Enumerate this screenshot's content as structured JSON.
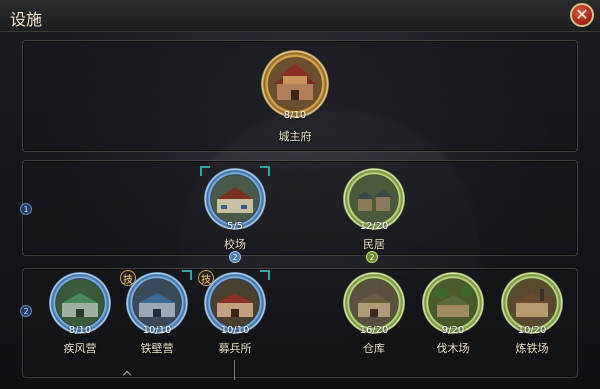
{
  "window": {
    "title": "设施",
    "close_icon": "close-icon"
  },
  "tiers": {
    "tier1": "1",
    "tier2": "2"
  },
  "buildings": {
    "palace": {
      "name": "城主府",
      "count": "8/10",
      "frame": "gold"
    },
    "drill": {
      "name": "校场",
      "count": "5/5",
      "frame": "blue"
    },
    "housing": {
      "name": "民居",
      "count": "12/20",
      "frame": "green"
    },
    "swift": {
      "name": "疾风营",
      "count": "8/10",
      "frame": "blue"
    },
    "iron": {
      "name": "铁壁营",
      "count": "10/10",
      "frame": "blue"
    },
    "recruit": {
      "name": "募兵所",
      "count": "10/10",
      "frame": "blue"
    },
    "warehouse": {
      "name": "仓库",
      "count": "16/20",
      "frame": "green"
    },
    "lumber": {
      "name": "伐木场",
      "count": "9/20",
      "frame": "green"
    },
    "smelter": {
      "name": "炼铁场",
      "count": "10/20",
      "frame": "green"
    }
  },
  "badges": {
    "skill": "技"
  },
  "requirements": {
    "drill_req": "2",
    "housing_req": "2"
  },
  "colors": {
    "gold": "#e3b45a",
    "blue": "#86b8e8",
    "green": "#c9e08a"
  }
}
